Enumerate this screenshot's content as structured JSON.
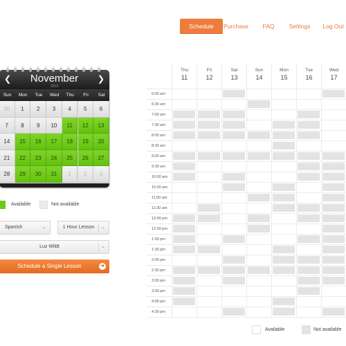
{
  "nav": {
    "items": [
      "Schedule",
      "Purchase",
      "FAQ",
      "Settings",
      "Log Out"
    ],
    "active": "Schedule"
  },
  "calendar": {
    "month": "November",
    "year": "2013",
    "prev_icon": "chevron-left-icon",
    "next_icon": "chevron-right-icon",
    "weekdays": [
      "Sun",
      "Mon",
      "Tue",
      "Wed",
      "Thu",
      "Fri",
      "Sat"
    ],
    "weeks": [
      [
        "30",
        "1",
        "2",
        "3",
        "4",
        "5",
        "6"
      ],
      [
        "7",
        "8",
        "9",
        "10",
        "11",
        "12",
        "13"
      ],
      [
        "14",
        "15",
        "16",
        "17",
        "18",
        "19",
        "20"
      ],
      [
        "21",
        "22",
        "23",
        "24",
        "25",
        "26",
        "27"
      ],
      [
        "28",
        "29",
        "30",
        "31",
        "1",
        "2",
        "3"
      ]
    ],
    "available_days": [
      "11",
      "12",
      "13",
      "15",
      "16",
      "17",
      "18",
      "19",
      "20",
      "22",
      "23",
      "24",
      "25",
      "26",
      "27",
      "29",
      "30",
      "31"
    ],
    "available_color": "#6ccb1b"
  },
  "legend": {
    "available_label": "Available",
    "not_available_label": "Not available",
    "available_color": "#6ccb1b",
    "not_available_color": "#e3e3e3"
  },
  "form": {
    "language": "Spanish",
    "lesson_length": "1 Hour Lesson",
    "teacher": "Luz Wildt",
    "submit_label": "Schedule a Single Lesson",
    "submit_icon": "arrow-right-circle-icon",
    "accent_color": "#ee7d3d"
  },
  "schedule": {
    "days": [
      {
        "name": "Thu",
        "date": "11"
      },
      {
        "name": "Fri",
        "date": "12"
      },
      {
        "name": "Sat",
        "date": "13"
      },
      {
        "name": "Sun",
        "date": "14"
      },
      {
        "name": "Mon",
        "date": "15"
      },
      {
        "name": "Tue",
        "date": "16"
      },
      {
        "name": "Wed",
        "date": "17"
      }
    ],
    "times": [
      "6:00 am",
      "6:30 am",
      "7:00 am",
      "7:30 am",
      "8:00 am",
      "8:30 am",
      "9:00 am",
      "9:30 am",
      "10:00 am",
      "10:30 am",
      "11:00 am",
      "11:30 am",
      "12:00 pm",
      "12:30 pm",
      "1:00 pm",
      "1:30 pm",
      "2:00 pm",
      "2:30 pm",
      "3:00 pm",
      "3:30 pm",
      "4:00 pm",
      "4:30 pm"
    ],
    "unavailable_slots": [
      [
        0,
        2
      ],
      [
        0,
        6
      ],
      [
        1,
        3
      ],
      [
        2,
        0
      ],
      [
        2,
        1
      ],
      [
        2,
        2
      ],
      [
        2,
        5
      ],
      [
        3,
        0
      ],
      [
        3,
        1
      ],
      [
        3,
        2
      ],
      [
        3,
        4
      ],
      [
        3,
        5
      ],
      [
        4,
        0
      ],
      [
        4,
        1
      ],
      [
        4,
        2
      ],
      [
        4,
        3
      ],
      [
        4,
        4
      ],
      [
        4,
        5
      ],
      [
        5,
        4
      ],
      [
        6,
        0
      ],
      [
        6,
        1
      ],
      [
        6,
        2
      ],
      [
        6,
        3
      ],
      [
        6,
        4
      ],
      [
        6,
        5
      ],
      [
        6,
        6
      ],
      [
        7,
        0
      ],
      [
        7,
        5
      ],
      [
        7,
        6
      ],
      [
        8,
        0
      ],
      [
        8,
        2
      ],
      [
        8,
        5
      ],
      [
        8,
        6
      ],
      [
        9,
        2
      ],
      [
        9,
        4
      ],
      [
        9,
        6
      ],
      [
        10,
        3
      ],
      [
        10,
        4
      ],
      [
        10,
        6
      ],
      [
        11,
        1
      ],
      [
        11,
        4
      ],
      [
        11,
        5
      ],
      [
        11,
        6
      ],
      [
        12,
        0
      ],
      [
        12,
        1
      ],
      [
        12,
        3
      ],
      [
        12,
        5
      ],
      [
        12,
        6
      ],
      [
        13,
        0
      ],
      [
        13,
        3
      ],
      [
        13,
        6
      ],
      [
        14,
        0
      ],
      [
        14,
        2
      ],
      [
        14,
        5
      ],
      [
        14,
        6
      ],
      [
        15,
        0
      ],
      [
        15,
        1
      ],
      [
        15,
        4
      ],
      [
        15,
        6
      ],
      [
        16,
        2
      ],
      [
        16,
        4
      ],
      [
        16,
        5
      ],
      [
        16,
        6
      ],
      [
        17,
        0
      ],
      [
        17,
        1
      ],
      [
        17,
        2
      ],
      [
        17,
        3
      ],
      [
        17,
        4
      ],
      [
        17,
        5
      ],
      [
        17,
        6
      ],
      [
        18,
        0
      ],
      [
        18,
        2
      ],
      [
        18,
        5
      ],
      [
        18,
        6
      ],
      [
        19,
        0
      ],
      [
        19,
        5
      ],
      [
        20,
        0
      ],
      [
        20,
        4
      ],
      [
        21,
        2
      ],
      [
        21,
        4
      ],
      [
        21,
        6
      ]
    ],
    "legend": {
      "available_label": "Available",
      "not_available_label": "Not available"
    }
  }
}
